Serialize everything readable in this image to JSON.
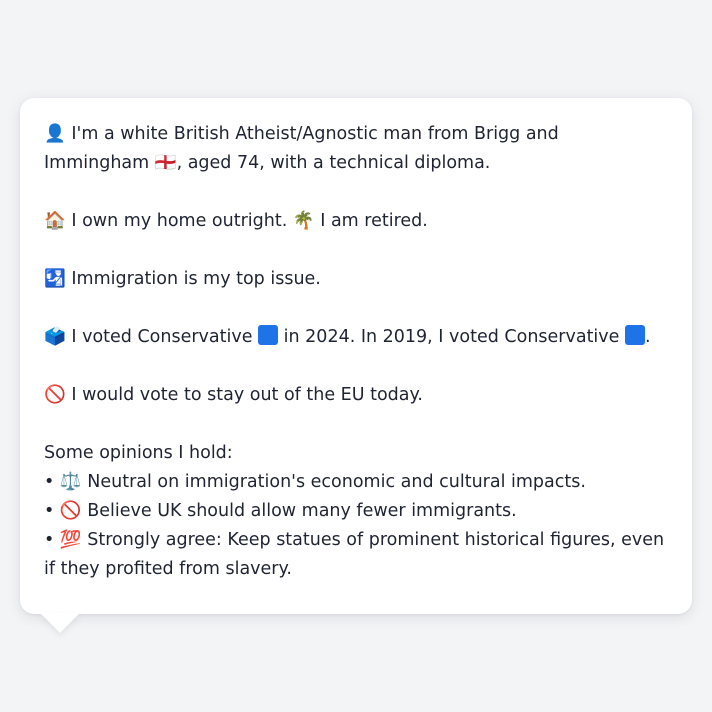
{
  "intro": {
    "icon": "👤",
    "text": "I'm a white British Atheist/Agnostic man from Brigg and Immingham",
    "flag": "🏴󠁧󠁢󠁥󠁮󠁧󠁿",
    "text_after": ", aged 74, with a technical diploma."
  },
  "housing": {
    "home_icon": "🏠",
    "home_text": "I own my home outright.",
    "retired_icon": "🌴",
    "retired_text": "I am retired."
  },
  "issue": {
    "icon": "🛂",
    "text": "Immigration is my top issue."
  },
  "vote": {
    "icon": "🗳️",
    "text_a": "I voted Conservative",
    "text_b": "in 2024. In 2019, I voted Conservative",
    "text_c": ".",
    "party_color": "#1E73E8"
  },
  "eu": {
    "icon": "🚫",
    "text": "I would vote to stay out of the EU today."
  },
  "opinions": {
    "heading": "Some opinions I hold:",
    "bullet": "•",
    "items": [
      {
        "icon": "⚖️",
        "text": "Neutral on immigration's economic and cultural impacts."
      },
      {
        "icon": "🚫",
        "text": "Believe UK should allow many fewer immigrants."
      },
      {
        "icon": "💯",
        "text": "Strongly agree: Keep statues of prominent historical figures, even if they profited from slavery."
      }
    ]
  }
}
